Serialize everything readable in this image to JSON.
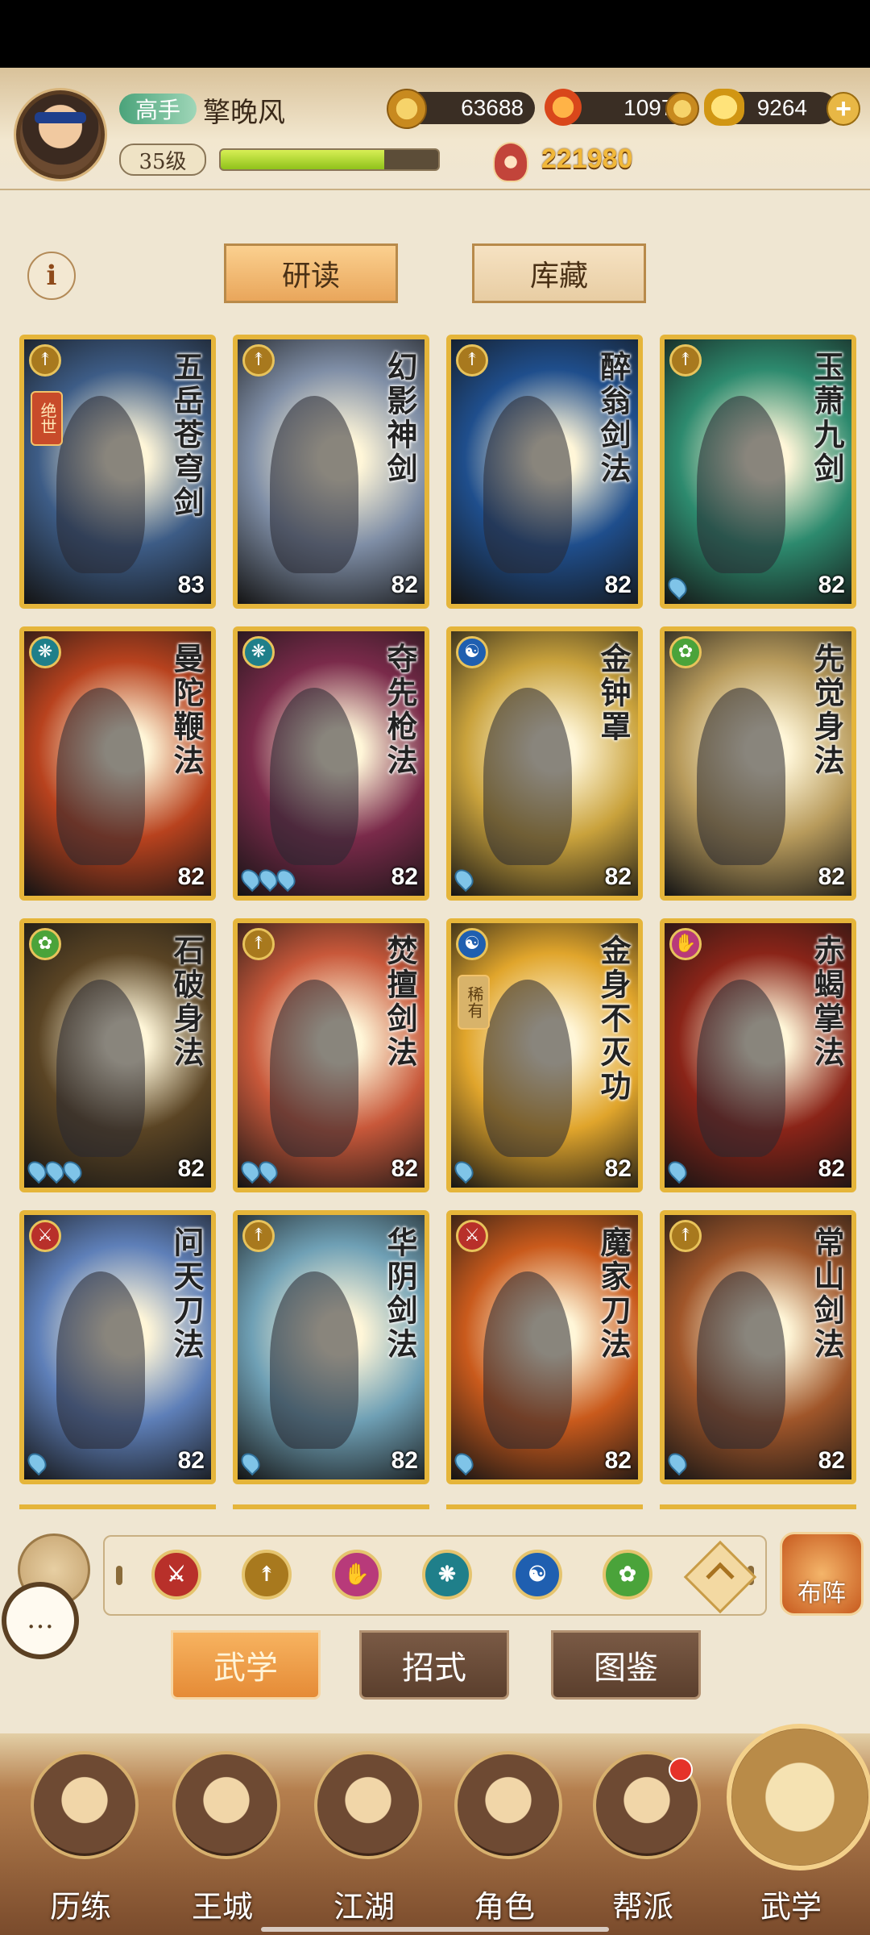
{
  "player": {
    "rank": "高手",
    "name": "擎晚风",
    "level": "35级",
    "exp_fraction": 0.75,
    "power": "221980"
  },
  "resources": {
    "copper": "63688",
    "flame": "10971",
    "gold": "9264",
    "plus_label": "+"
  },
  "info_label": "i",
  "tabs": {
    "study": "研读",
    "storage": "库藏"
  },
  "cards": [
    {
      "name": "五岳苍穹剑",
      "level": "83",
      "school": "sword",
      "tag": "绝世",
      "drops": 0,
      "art": "#3d5c86"
    },
    {
      "name": "幻影神剑",
      "level": "82",
      "school": "sword",
      "tag": "",
      "drops": 0,
      "art": "#7f8ea6"
    },
    {
      "name": "醉翁剑法",
      "level": "82",
      "school": "sword",
      "tag": "",
      "drops": 0,
      "art": "#1f4e8c"
    },
    {
      "name": "玉萧九剑",
      "level": "82",
      "school": "sword",
      "tag": "",
      "drops": 1,
      "art": "#2d8a6e"
    },
    {
      "name": "曼陀鞭法",
      "level": "82",
      "school": "whip",
      "tag": "",
      "drops": 0,
      "art": "#b8421e"
    },
    {
      "name": "夺先枪法",
      "level": "82",
      "school": "whip",
      "tag": "",
      "drops": 3,
      "art": "#7a2a4a"
    },
    {
      "name": "金钟罩",
      "level": "82",
      "school": "taiji",
      "tag": "",
      "drops": 1,
      "art": "#c9a23c"
    },
    {
      "name": "先觉身法",
      "level": "82",
      "school": "body",
      "tag": "",
      "drops": 0,
      "art": "#b89b5c"
    },
    {
      "name": "石破身法",
      "level": "82",
      "school": "body",
      "tag": "",
      "drops": 3,
      "art": "#5a4424"
    },
    {
      "name": "焚擅剑法",
      "level": "82",
      "school": "sword",
      "tag": "",
      "drops": 2,
      "art": "#c8583a"
    },
    {
      "name": "金身不灭功",
      "level": "82",
      "school": "taiji",
      "tag": "稀有",
      "drops": 1,
      "art": "#e0a52c"
    },
    {
      "name": "赤蝎掌法",
      "level": "82",
      "school": "palm",
      "tag": "",
      "drops": 1,
      "art": "#8a2418"
    },
    {
      "name": "问天刀法",
      "level": "82",
      "school": "blade",
      "tag": "",
      "drops": 1,
      "art": "#5e7fb8"
    },
    {
      "name": "华阴剑法",
      "level": "82",
      "school": "sword",
      "tag": "",
      "drops": 1,
      "art": "#6fa0b5"
    },
    {
      "name": "魔家刀法",
      "level": "82",
      "school": "blade",
      "tag": "",
      "drops": 1,
      "art": "#c95a1c"
    },
    {
      "name": "常山剑法",
      "level": "82",
      "school": "sword",
      "tag": "",
      "drops": 1,
      "art": "#a0562a"
    }
  ],
  "school_colors": {
    "sword": "#a8791e",
    "whip": "#1f7f8a",
    "taiji": "#1f5fb0",
    "body": "#4aa33a",
    "palm": "#b83a7a",
    "blade": "#b8302a"
  },
  "school_glyphs": {
    "sword": "↟",
    "whip": "❋",
    "taiji": "☯",
    "body": "✿",
    "palm": "✋",
    "blade": "⚔"
  },
  "filters": [
    {
      "name": "blade",
      "color": "#b8302a"
    },
    {
      "name": "sword",
      "color": "#a8791e"
    },
    {
      "name": "palm",
      "color": "#b83a7a"
    },
    {
      "name": "whip",
      "color": "#1f7f8a"
    },
    {
      "name": "taiji",
      "color": "#1f5fb0"
    },
    {
      "name": "body",
      "color": "#4aa33a"
    }
  ],
  "buzhen_label": "布阵",
  "chat_icon": "…",
  "section_tabs": {
    "martial": "武学",
    "moves": "招式",
    "atlas": "图鉴"
  },
  "nav": [
    {
      "label": "历练"
    },
    {
      "label": "王城"
    },
    {
      "label": "江湖"
    },
    {
      "label": "角色"
    },
    {
      "label": "帮派"
    },
    {
      "label": "武学"
    }
  ]
}
